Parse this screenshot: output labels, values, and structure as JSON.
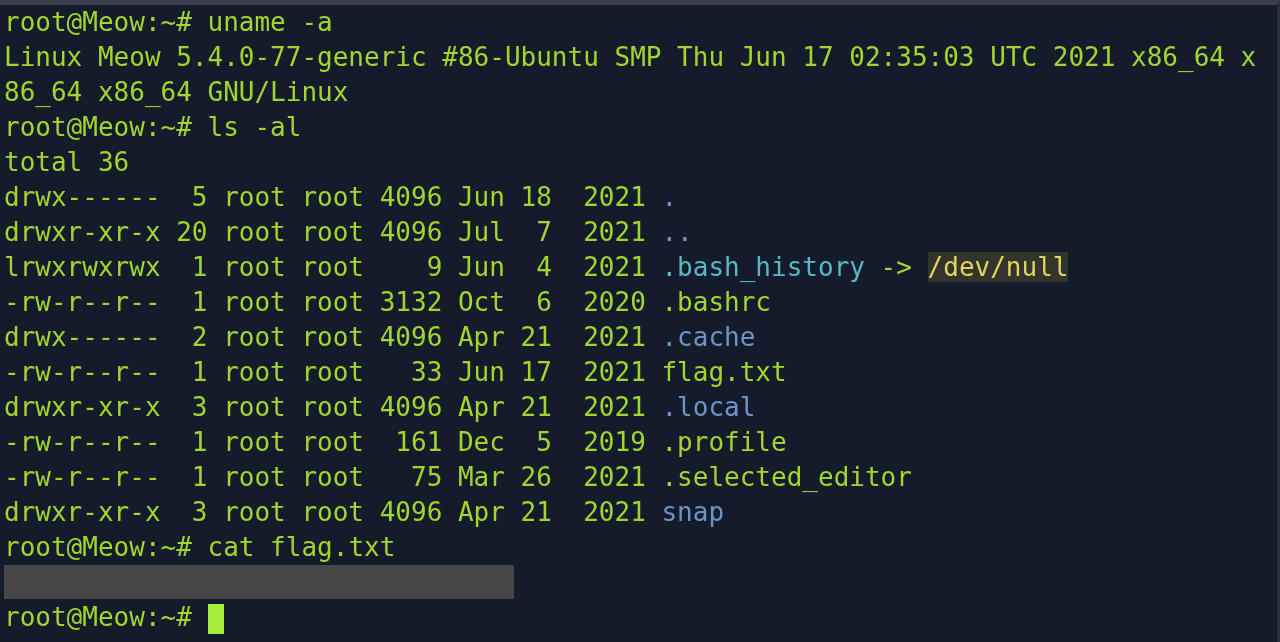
{
  "terminal": {
    "lines": [
      {
        "kind": "prompt",
        "prompt": "root@Meow:~#",
        "command": "uname -a",
        "cursor": false
      },
      {
        "kind": "output",
        "text": "Linux Meow 5.4.0-77-generic #86-Ubuntu SMP Thu Jun 17 02:35:03 UTC 2021 x86_64 x"
      },
      {
        "kind": "output",
        "text": "86_64 x86_64 GNU/Linux"
      },
      {
        "kind": "prompt",
        "prompt": "root@Meow:~#",
        "command": "ls -al",
        "cursor": false
      },
      {
        "kind": "output",
        "text": "total 36"
      },
      {
        "kind": "entry",
        "fields": "drwx------  5 root root 4096 Jun 18  2021",
        "name": ".",
        "color": "#6f93c6"
      },
      {
        "kind": "entry",
        "fields": "drwxr-xr-x 20 root root 4096 Jul  7  2021",
        "name": "..",
        "color": "#6f93c6"
      },
      {
        "kind": "entry",
        "fields": "lrwxrwxrwx  1 root root    9 Jun  4  2021",
        "name": ".bash_history",
        "color": "#5ab7c6",
        "arrow": "->",
        "target": "/dev/null"
      },
      {
        "kind": "entry",
        "fields": "-rw-r--r--  1 root root 3132 Oct  6  2020",
        "name": ".bashrc",
        "color": "#a2d62f"
      },
      {
        "kind": "entry",
        "fields": "drwx------  2 root root 4096 Apr 21  2021",
        "name": ".cache",
        "color": "#6f93c6"
      },
      {
        "kind": "entry",
        "fields": "-rw-r--r--  1 root root   33 Jun 17  2021",
        "name": "flag.txt",
        "color": "#a2d62f"
      },
      {
        "kind": "entry",
        "fields": "drwxr-xr-x  3 root root 4096 Apr 21  2021",
        "name": ".local",
        "color": "#6f93c6"
      },
      {
        "kind": "entry",
        "fields": "-rw-r--r--  1 root root  161 Dec  5  2019",
        "name": ".profile",
        "color": "#a2d62f"
      },
      {
        "kind": "entry",
        "fields": "-rw-r--r--  1 root root   75 Mar 26  2021",
        "name": ".selected_editor",
        "color": "#a2d62f"
      },
      {
        "kind": "entry",
        "fields": "drwxr-xr-x  3 root root 4096 Apr 21  2021",
        "name": "snap",
        "color": "#6f93c6"
      },
      {
        "kind": "prompt",
        "prompt": "root@Meow:~#",
        "command": "cat flag.txt",
        "cursor": false
      },
      {
        "kind": "redacted"
      },
      {
        "kind": "prompt",
        "prompt": "root@Meow:~#",
        "cursor": true
      }
    ]
  }
}
